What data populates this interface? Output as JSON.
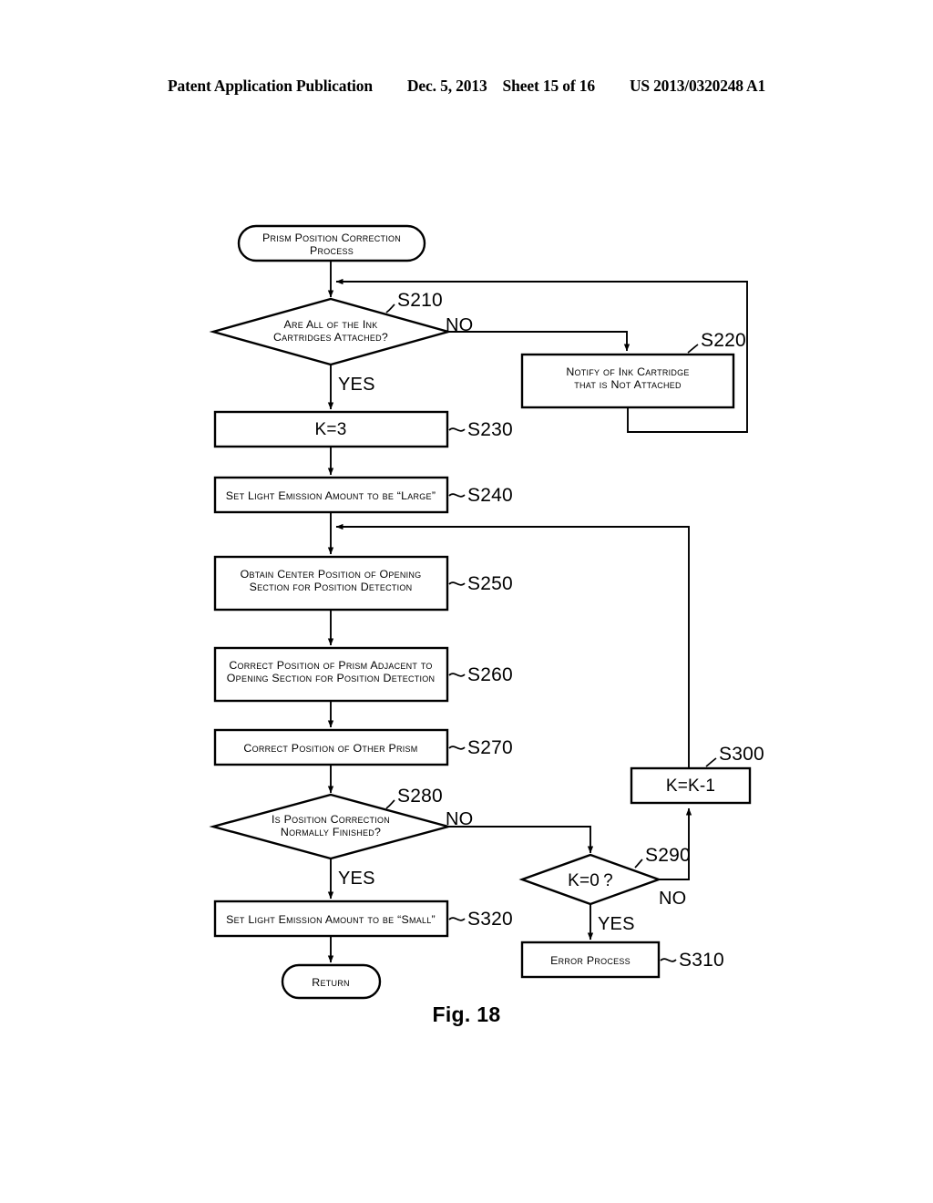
{
  "header": {
    "publication": "Patent Application Publication",
    "date": "Dec. 5, 2013",
    "sheet": "Sheet 15 of 16",
    "patent_number": "US 2013/0320248 A1"
  },
  "figure": {
    "caption": "Fig. 18",
    "title": "Prism Position Correction Process flowchart"
  },
  "nodes": {
    "start": {
      "id": "start",
      "type": "terminator",
      "line1": "Prism Position Correction",
      "line2": "Process"
    },
    "s210": {
      "id": "S210",
      "type": "decision",
      "step": "S210",
      "line1": "Are All of the Ink",
      "line2": "Cartridges Attached?",
      "yes": "YES",
      "no": "NO"
    },
    "s220": {
      "id": "S220",
      "type": "process",
      "step": "S220",
      "line1": "Notify of Ink Cartridge",
      "line2": "that is Not Attached"
    },
    "s230": {
      "id": "S230",
      "type": "process",
      "step": "S230",
      "line1": "K=3"
    },
    "s240": {
      "id": "S240",
      "type": "process",
      "step": "S240",
      "line1": "Set Light Emission Amount to be “Large”"
    },
    "s250": {
      "id": "S250",
      "type": "process",
      "step": "S250",
      "line1": "Obtain Center Position of Opening",
      "line2": "Section for Position Detection"
    },
    "s260": {
      "id": "S260",
      "type": "process",
      "step": "S260",
      "line1": "Correct Position of Prism Adjacent to",
      "line2": "Opening Section for Position Detection"
    },
    "s270": {
      "id": "S270",
      "type": "process",
      "step": "S270",
      "line1": "Correct Position of Other Prism"
    },
    "s280": {
      "id": "S280",
      "type": "decision",
      "step": "S280",
      "line1": "Is Position Correction",
      "line2": "Normally Finished?",
      "yes": "YES",
      "no": "NO"
    },
    "s290": {
      "id": "S290",
      "type": "decision",
      "step": "S290",
      "line1": "K=0 ?",
      "yes": "YES",
      "no": "NO"
    },
    "s300": {
      "id": "S300",
      "type": "process",
      "step": "S300",
      "line1": "K=K-1"
    },
    "s310": {
      "id": "S310",
      "type": "process",
      "step": "S310",
      "line1": "Error Process"
    },
    "s320": {
      "id": "S320",
      "type": "process",
      "step": "S320",
      "line1": "Set Light Emission Amount to be “Small”"
    },
    "return": {
      "id": "return",
      "type": "terminator",
      "line1": "Return"
    }
  },
  "edges": [
    {
      "name": "start-to-s210",
      "from": "start",
      "to": "S210",
      "label": ""
    },
    {
      "name": "s210-no-to-s220",
      "from": "S210",
      "to": "S220",
      "label": "NO"
    },
    {
      "name": "s220-loop-to-s210",
      "from": "S220",
      "to": "S210",
      "label": ""
    },
    {
      "name": "s210-yes-to-s230",
      "from": "S210",
      "to": "S230",
      "label": "YES"
    },
    {
      "name": "s230-to-s240",
      "from": "S230",
      "to": "S240",
      "label": ""
    },
    {
      "name": "s240-to-s250",
      "from": "S240",
      "to": "S250",
      "label": ""
    },
    {
      "name": "s250-to-s260",
      "from": "S250",
      "to": "S260",
      "label": ""
    },
    {
      "name": "s260-to-s270",
      "from": "S260",
      "to": "S270",
      "label": ""
    },
    {
      "name": "s270-to-s280",
      "from": "S270",
      "to": "S280",
      "label": ""
    },
    {
      "name": "s280-yes-to-s320",
      "from": "S280",
      "to": "S320",
      "label": "YES"
    },
    {
      "name": "s280-no-to-s290",
      "from": "S280",
      "to": "S290",
      "label": "NO"
    },
    {
      "name": "s290-no-to-s300",
      "from": "S290",
      "to": "S300",
      "label": "NO"
    },
    {
      "name": "s290-yes-to-s310",
      "from": "S290",
      "to": "S310",
      "label": "YES"
    },
    {
      "name": "s300-loop-to-s250",
      "from": "S300",
      "to": "S250",
      "label": ""
    },
    {
      "name": "s320-to-return",
      "from": "S320",
      "to": "return",
      "label": ""
    }
  ],
  "colors": {
    "ink": "#000000",
    "paper": "#ffffff"
  }
}
